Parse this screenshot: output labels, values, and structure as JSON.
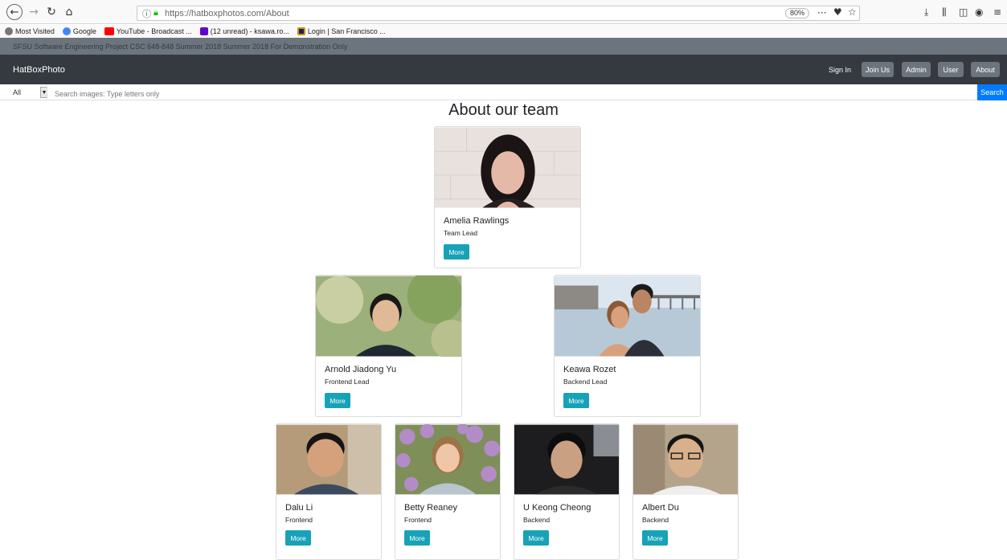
{
  "browser": {
    "url": "https://hatboxphotos.com/About",
    "zoom": "80%",
    "bookmarks": [
      {
        "label": "Most Visited",
        "color": "#666666"
      },
      {
        "label": "Google",
        "color": "#4285f4"
      },
      {
        "label": "YouTube - Broadcast ...",
        "color": "#ff0000"
      },
      {
        "label": "(12 unread) - ksawa.ro...",
        "color": "#5f01d1"
      },
      {
        "label": "Login | San Francisco ...",
        "color": "#231f5c"
      }
    ]
  },
  "notice": "SFSU Software Engineering Project CSC 648-848 Summer 2018 Summer 2018 For Demonstration Only",
  "navbar": {
    "brand": "HatBoxPhoto",
    "sign_in": "Sign In",
    "join_us": "Join Us",
    "admin": "Admin",
    "user": "User",
    "about": "About"
  },
  "search": {
    "category": "All",
    "placeholder": "Search images: Type letters only",
    "button": "Search"
  },
  "page_title": "About our team",
  "team": [
    {
      "name": "Amelia Rawlings",
      "role": "Team Lead",
      "more": "More"
    },
    {
      "name": "Arnold Jiadong Yu",
      "role": "Frontend Lead",
      "more": "More"
    },
    {
      "name": "Keawa Rozet",
      "role": "Backend Lead",
      "more": "More"
    },
    {
      "name": "Dalu Li",
      "role": "Frontend",
      "more": "More"
    },
    {
      "name": "Betty Reaney",
      "role": "Frontend",
      "more": "More"
    },
    {
      "name": "U Keong Cheong",
      "role": "Backend",
      "more": "More"
    },
    {
      "name": "Albert Du",
      "role": "Backend",
      "more": "More"
    }
  ]
}
